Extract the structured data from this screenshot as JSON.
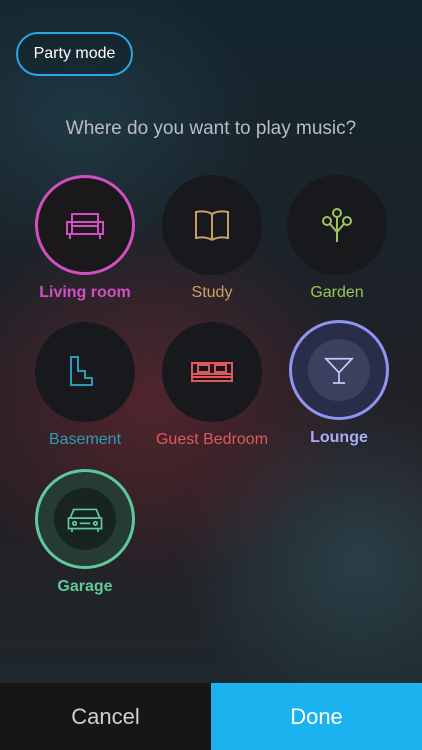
{
  "party_mode": {
    "label": "Party mode"
  },
  "prompt": "Where do you want to play music?",
  "rooms": [
    {
      "label": "Living room",
      "icon": "sofa-icon",
      "color": "#d24fc0",
      "selected": true
    },
    {
      "label": "Study",
      "icon": "book-icon",
      "color": "#c9a063",
      "selected": false
    },
    {
      "label": "Garden",
      "icon": "tree-icon",
      "color": "#9cc55a",
      "selected": false
    },
    {
      "label": "Basement",
      "icon": "stairs-icon",
      "color": "#2f9ab7",
      "selected": false
    },
    {
      "label": "Guest Bedroom",
      "icon": "bed-icon",
      "color": "#e0585d",
      "selected": false
    },
    {
      "label": "Lounge",
      "icon": "cocktail-icon",
      "color": "#8e95f0",
      "selected": true
    },
    {
      "label": "Garage",
      "icon": "car-icon",
      "color": "#5fc99c",
      "selected": true
    }
  ],
  "footer": {
    "cancel_label": "Cancel",
    "done_label": "Done"
  },
  "colors": {
    "accent": "#1ab3ef",
    "party_border": "#28a8e8"
  }
}
